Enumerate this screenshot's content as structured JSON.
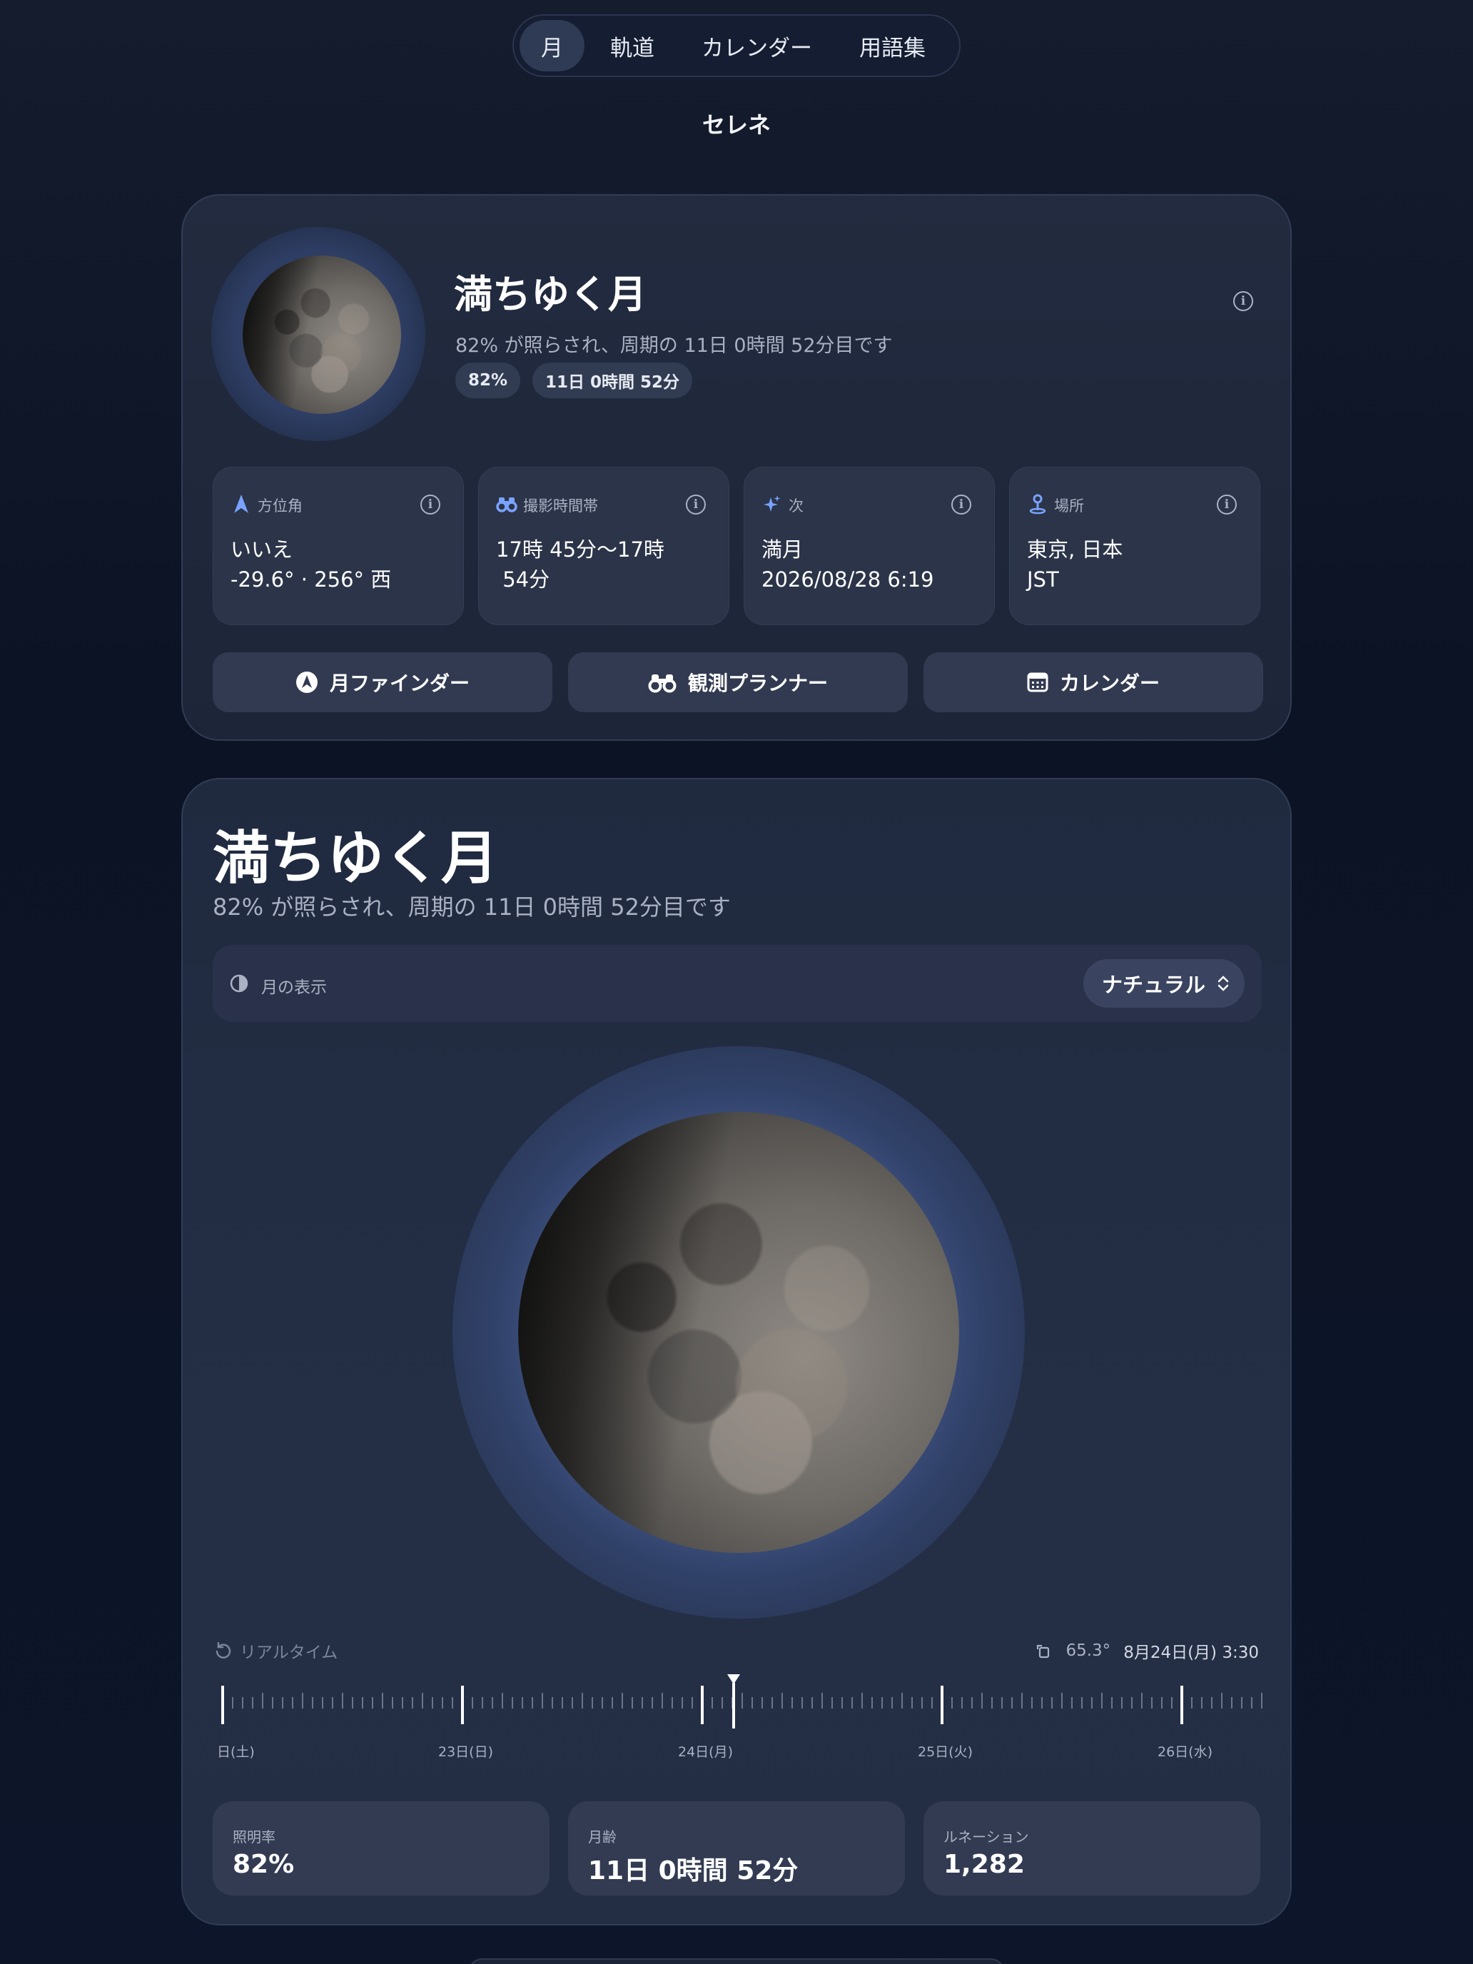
{
  "nav": {
    "tabs": [
      {
        "label": "月",
        "active": true
      },
      {
        "label": "軌道",
        "active": false
      },
      {
        "label": "カレンダー",
        "active": false
      },
      {
        "label": "用語集",
        "active": false
      }
    ]
  },
  "app_title": "セレネ",
  "summary": {
    "title": "満ちゆく月",
    "subtitle": "82% が照らされ、周期の 11日 0時間 52分目です",
    "pills": [
      "82%",
      "11日 0時間 52分"
    ],
    "tiles": [
      {
        "icon": "navigation-arrow-icon",
        "label": "方位角",
        "line1": "いいえ",
        "line2": "-29.6° · 256° 西"
      },
      {
        "icon": "binoculars-icon",
        "label": "撮影時間帯",
        "line1": "17時 45分〜17時",
        "line2": " 54分"
      },
      {
        "icon": "sparkles-icon",
        "label": "次",
        "line1": "満月",
        "line2": "2026/08/28 6:19"
      },
      {
        "icon": "location-pin-icon",
        "label": "場所",
        "line1": "東京, 日本",
        "line2": "JST"
      }
    ],
    "actions": [
      {
        "icon": "compass-icon",
        "label": "月ファインダー"
      },
      {
        "icon": "binoculars-icon",
        "label": "観測プランナー"
      },
      {
        "icon": "calendar-icon",
        "label": "カレンダー"
      }
    ]
  },
  "detail": {
    "title": "満ちゆく月",
    "subtitle": "82% が照らされ、周期の 11日 0時間 52分目です",
    "display_label": "月の表示",
    "display_mode": "ナチュラル",
    "realtime_label": "リアルタイム",
    "rotation": "65.3°",
    "datetime": "8月24日(月) 3:30",
    "timeline_dates": [
      "日(土)",
      "23日(日)",
      "24日(月)",
      "25日(火)",
      "26日(水)"
    ],
    "stats": [
      {
        "label": "照明率",
        "value": "82%"
      },
      {
        "label": "月齢",
        "value": "11日 0時間 52分"
      },
      {
        "label": "ルネーション",
        "value": "1,282"
      }
    ]
  },
  "colors": {
    "accent": "#7aa2ff",
    "background": "#0b1324",
    "card": "#222b3f"
  }
}
